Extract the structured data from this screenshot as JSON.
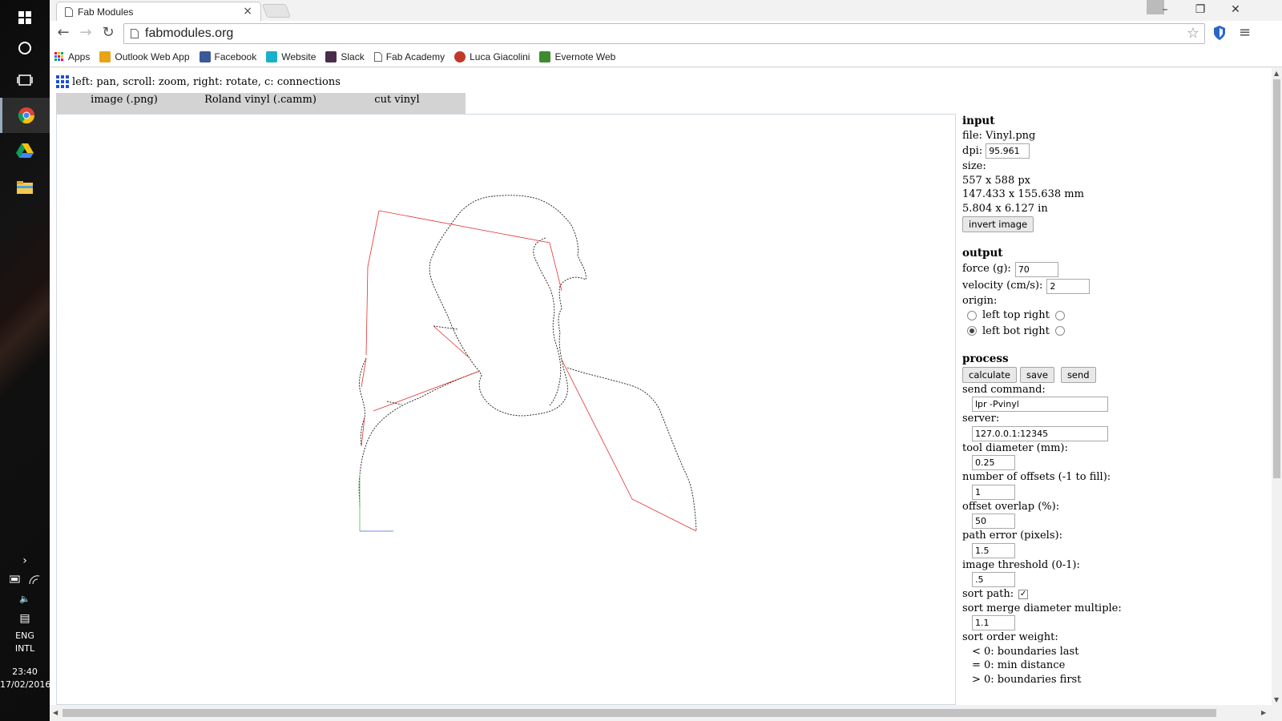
{
  "taskbar": {
    "tray": {
      "language": "ENG",
      "layout": "INTL",
      "time": "23:40",
      "date": "17/02/2016"
    }
  },
  "browser": {
    "tab_title": "Fab Modules",
    "tab_close": "×",
    "url": "fabmodules.org",
    "bookmarks": [
      {
        "label": "Apps",
        "color": "#4a7de0"
      },
      {
        "label": "Outlook Web App",
        "color": "#e8a318"
      },
      {
        "label": "Facebook",
        "color": "#3b5998"
      },
      {
        "label": "Website",
        "color": "#1ab0c9"
      },
      {
        "label": "Slack",
        "color": "#4b2d4b"
      },
      {
        "label": "Fab Academy",
        "color": "#9a9a9a"
      },
      {
        "label": "Luca Giacolini",
        "color": "#c0392b"
      },
      {
        "label": "Evernote Web",
        "color": "#3e8a2e"
      }
    ]
  },
  "page": {
    "hint": "left: pan, scroll: zoom, right: rotate, c: connections",
    "modules": [
      "image (.png)",
      "Roland vinyl (.camm)",
      "cut vinyl"
    ],
    "input": {
      "heading": "input",
      "file": "file: Vinyl.png",
      "dpi_label": "dpi:",
      "dpi": "95.961",
      "size_label": "size:",
      "size_px": "557 x 588 px",
      "size_mm": "147.433 x 155.638 mm",
      "size_in": "5.804 x 6.127 in",
      "invert_button": "invert image"
    },
    "output": {
      "heading": "output",
      "force_label": "force (g):",
      "force": "70",
      "velocity_label": "velocity (cm/s):",
      "velocity": "2",
      "origin_label": "origin:",
      "origin_row1": "left top right",
      "origin_row2": "left bot right"
    },
    "process": {
      "heading": "process",
      "calculate": "calculate",
      "save": "save",
      "send": "send",
      "send_command_label": "send command:",
      "send_command": "lpr -Pvinyl",
      "server_label": "server:",
      "server": "127.0.0.1:12345",
      "tool_diameter_label": "tool diameter (mm):",
      "tool_diameter": "0.25",
      "offsets_label": "number of offsets (-1 to fill):",
      "offsets": "1",
      "overlap_label": "offset overlap (%):",
      "overlap": "50",
      "path_error_label": "path error (pixels):",
      "path_error": "1.5",
      "threshold_label": "image threshold (0-1):",
      "threshold": ".5",
      "sort_path_label": "sort path:",
      "sort_merge_label": "sort merge diameter multiple:",
      "sort_merge": "1.1",
      "sort_order_label": "sort order weight:",
      "sort_order_1": "< 0: boundaries last",
      "sort_order_2": "= 0: min distance",
      "sort_order_3": "> 0: boundaries first"
    }
  }
}
